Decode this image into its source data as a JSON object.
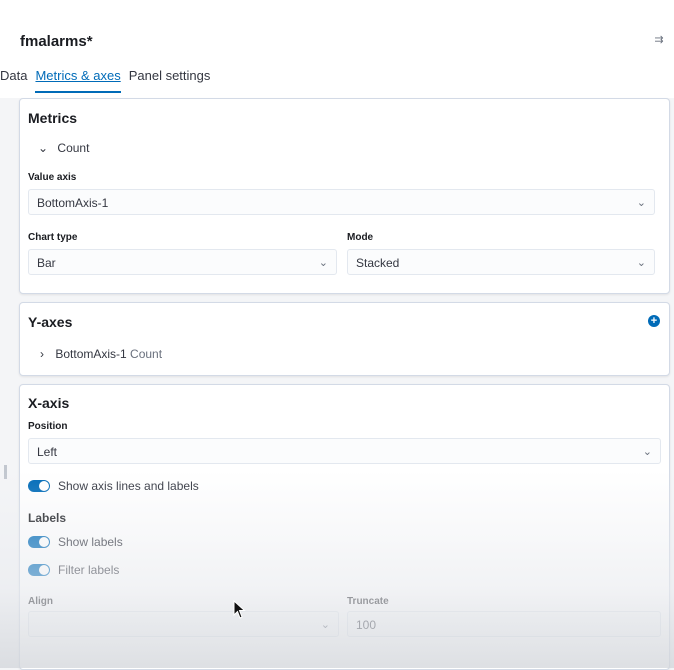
{
  "header": {
    "title": "fmalarms*",
    "tabs": [
      {
        "label": "Data",
        "active": false
      },
      {
        "label": "Metrics & axes",
        "active": true
      },
      {
        "label": "Panel settings",
        "active": false
      }
    ],
    "collapse_icon": "collapse-icon"
  },
  "metrics": {
    "heading": "Metrics",
    "item_label": "Count",
    "value_axis_label": "Value axis",
    "value_axis_value": "BottomAxis-1",
    "chart_type_label": "Chart type",
    "chart_type_value": "Bar",
    "mode_label": "Mode",
    "mode_value": "Stacked"
  },
  "y_axes": {
    "heading": "Y-axes",
    "item_label": "BottomAxis-1",
    "item_sub": "Count",
    "add_icon": "plus-circle-icon"
  },
  "x_axis": {
    "heading": "X-axis",
    "position_label": "Position",
    "position_value": "Left",
    "show_axis_lines_label": "Show axis lines and labels",
    "labels_heading": "Labels",
    "show_labels_label": "Show labels",
    "filter_labels_label": "Filter labels",
    "align_label": "Align",
    "align_value": "",
    "truncate_label": "Truncate",
    "truncate_value": "100"
  },
  "colors": {
    "accent": "#006bb8",
    "border": "#d3dae6"
  }
}
